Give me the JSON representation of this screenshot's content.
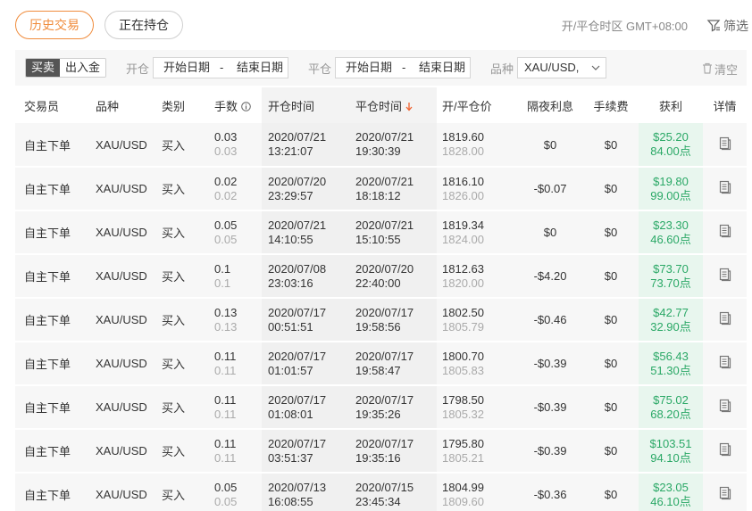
{
  "tabs": [
    {
      "label": "历史交易",
      "active": true
    },
    {
      "label": "正在持仓",
      "active": false
    }
  ],
  "timezone": "开/平仓时区 GMT+08:00",
  "filter_label": "筛选",
  "filterbar": {
    "direction": [
      "买卖",
      "出入金"
    ],
    "open_label": "开仓",
    "close_label": "平仓",
    "start_date": "开始日期",
    "end_date": "结束日期",
    "dash": "-",
    "symbol_label": "品种",
    "symbol_value": "XAU/USD,",
    "clear_label": "清空"
  },
  "headers": [
    "交易员",
    "品种",
    "类别",
    "手数",
    "开仓时间",
    "平仓时间",
    "开/平仓价",
    "隔夜利息",
    "手续费",
    "获利",
    "详情"
  ],
  "colors": {
    "accent": "#f08c3c",
    "profit": "#2aa866",
    "sort_arrow": "#f0612e"
  },
  "rows": [
    {
      "trader": "自主下单",
      "symbol": "XAU/USD",
      "type": "买入",
      "lots": "0.03",
      "lots2": "0.03",
      "open_date": "2020/07/21",
      "open_time": "13:21:07",
      "close_date": "2020/07/21",
      "close_time": "19:30:39",
      "price1": "1819.60",
      "price2": "1828.00",
      "swap": "$0",
      "fee": "$0",
      "profit": "$25.20",
      "points": "84.00点"
    },
    {
      "trader": "自主下单",
      "symbol": "XAU/USD",
      "type": "买入",
      "lots": "0.02",
      "lots2": "0.02",
      "open_date": "2020/07/20",
      "open_time": "23:29:57",
      "close_date": "2020/07/21",
      "close_time": "18:18:12",
      "price1": "1816.10",
      "price2": "1826.00",
      "swap": "-$0.07",
      "fee": "$0",
      "profit": "$19.80",
      "points": "99.00点"
    },
    {
      "trader": "自主下单",
      "symbol": "XAU/USD",
      "type": "买入",
      "lots": "0.05",
      "lots2": "0.05",
      "open_date": "2020/07/21",
      "open_time": "14:10:55",
      "close_date": "2020/07/21",
      "close_time": "15:10:55",
      "price1": "1819.34",
      "price2": "1824.00",
      "swap": "$0",
      "fee": "$0",
      "profit": "$23.30",
      "points": "46.60点"
    },
    {
      "trader": "自主下单",
      "symbol": "XAU/USD",
      "type": "买入",
      "lots": "0.1",
      "lots2": "0.1",
      "open_date": "2020/07/08",
      "open_time": "23:03:16",
      "close_date": "2020/07/20",
      "close_time": "22:40:00",
      "price1": "1812.63",
      "price2": "1820.00",
      "swap": "-$4.20",
      "fee": "$0",
      "profit": "$73.70",
      "points": "73.70点"
    },
    {
      "trader": "自主下单",
      "symbol": "XAU/USD",
      "type": "买入",
      "lots": "0.13",
      "lots2": "0.13",
      "open_date": "2020/07/17",
      "open_time": "00:51:51",
      "close_date": "2020/07/17",
      "close_time": "19:58:56",
      "price1": "1802.50",
      "price2": "1805.79",
      "swap": "-$0.46",
      "fee": "$0",
      "profit": "$42.77",
      "points": "32.90点"
    },
    {
      "trader": "自主下单",
      "symbol": "XAU/USD",
      "type": "买入",
      "lots": "0.11",
      "lots2": "0.11",
      "open_date": "2020/07/17",
      "open_time": "01:01:57",
      "close_date": "2020/07/17",
      "close_time": "19:58:47",
      "price1": "1800.70",
      "price2": "1805.83",
      "swap": "-$0.39",
      "fee": "$0",
      "profit": "$56.43",
      "points": "51.30点"
    },
    {
      "trader": "自主下单",
      "symbol": "XAU/USD",
      "type": "买入",
      "lots": "0.11",
      "lots2": "0.11",
      "open_date": "2020/07/17",
      "open_time": "01:08:01",
      "close_date": "2020/07/17",
      "close_time": "19:35:26",
      "price1": "1798.50",
      "price2": "1805.32",
      "swap": "-$0.39",
      "fee": "$0",
      "profit": "$75.02",
      "points": "68.20点"
    },
    {
      "trader": "自主下单",
      "symbol": "XAU/USD",
      "type": "买入",
      "lots": "0.11",
      "lots2": "0.11",
      "open_date": "2020/07/17",
      "open_time": "03:51:37",
      "close_date": "2020/07/17",
      "close_time": "19:35:16",
      "price1": "1795.80",
      "price2": "1805.21",
      "swap": "-$0.39",
      "fee": "$0",
      "profit": "$103.51",
      "points": "94.10点"
    },
    {
      "trader": "自主下单",
      "symbol": "XAU/USD",
      "type": "买入",
      "lots": "0.05",
      "lots2": "0.05",
      "open_date": "2020/07/13",
      "open_time": "16:08:55",
      "close_date": "2020/07/15",
      "close_time": "23:45:34",
      "price1": "1804.99",
      "price2": "1809.60",
      "swap": "-$0.36",
      "fee": "$0",
      "profit": "$23.05",
      "points": "46.10点"
    }
  ]
}
